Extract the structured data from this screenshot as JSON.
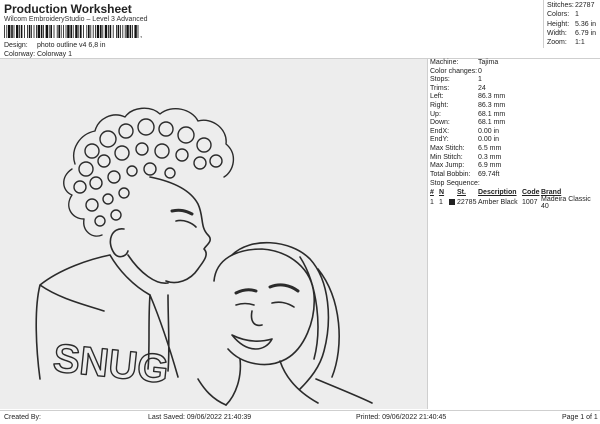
{
  "header": {
    "title": "Production Worksheet",
    "subtitle": "Wilcom EmbroideryStudio – Level 3 Advanced",
    "barcode_tail": ",",
    "design_label": "Design:",
    "design_value": "photo outline v4 6,8 in",
    "colorway_label": "Colorway:",
    "colorway_value": "Colorway 1"
  },
  "summary": [
    {
      "k": "Stitches:",
      "v": "22787"
    },
    {
      "k": "Colors:",
      "v": "1"
    },
    {
      "k": "Height:",
      "v": "5.36 in"
    },
    {
      "k": "Width:",
      "v": "6.79 in"
    },
    {
      "k": "Zoom:",
      "v": "1:1"
    }
  ],
  "machine": [
    {
      "k": "Machine:",
      "v": "Tajima"
    },
    {
      "k": "Color changes:",
      "v": "0"
    },
    {
      "k": "Stops:",
      "v": "1"
    },
    {
      "k": "Trims:",
      "v": "24"
    },
    {
      "k": "Left:",
      "v": "86.3 mm"
    },
    {
      "k": "Right:",
      "v": "86.3 mm"
    },
    {
      "k": "Up:",
      "v": "68.1 mm"
    },
    {
      "k": "Down:",
      "v": "68.1 mm"
    },
    {
      "k": "EndX:",
      "v": "0.00 in"
    },
    {
      "k": "EndY:",
      "v": "0.00 in"
    },
    {
      "k": "Max Stitch:",
      "v": "6.5 mm"
    },
    {
      "k": "Min Stitch:",
      "v": "0.3 mm"
    },
    {
      "k": "Max Jump:",
      "v": "6.9 mm"
    },
    {
      "k": "Total Bobbin:",
      "v": "69.74ft"
    }
  ],
  "stop_sequence": {
    "title": "Stop Sequence:",
    "headers": {
      "num": "#",
      "n": "N",
      "st": "St.",
      "description": "Description",
      "code": "Code",
      "brand": "Brand"
    },
    "rows": [
      {
        "num": "1",
        "n": "1",
        "st": "22785",
        "description": "Amber Black",
        "code": "1007",
        "brand": "Madeira Classic 40"
      }
    ]
  },
  "footer": {
    "created_by": "Created By:",
    "last_saved": "Last Saved: 09/06/2022 21:40:39",
    "printed": "Printed: 09/06/2022 21:40:45",
    "page": "Page 1 of 1"
  },
  "colors": {
    "thread": "#2b2b2b",
    "canvas": "#ededed"
  }
}
